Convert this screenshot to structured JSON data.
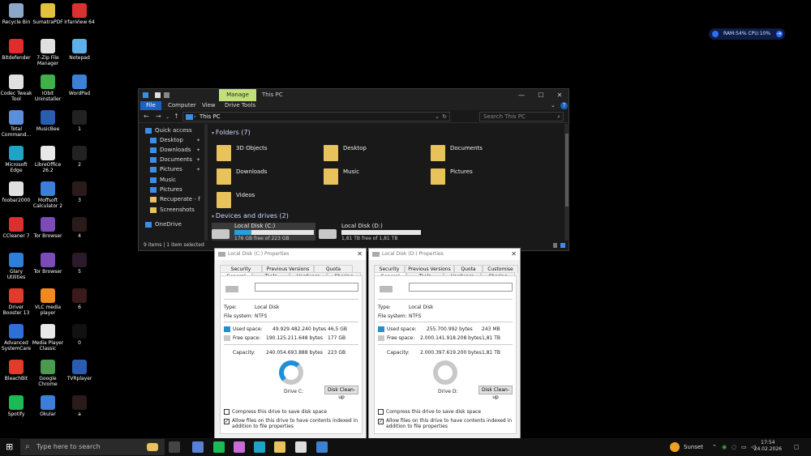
{
  "desktop": {
    "icons": [
      {
        "label": "Recycle Bin",
        "color": "#8aa6c9"
      },
      {
        "label": "SumatraPDF",
        "color": "#e3c03d"
      },
      {
        "label": "IrfanView 64",
        "color": "#d93030"
      },
      {
        "label": "Bitdefender",
        "color": "#e32b2b"
      },
      {
        "label": "7-Zip File Manager",
        "color": "#e0e0e0"
      },
      {
        "label": "Notepad",
        "color": "#5fb0e8"
      },
      {
        "label": "Codec Tweak Tool",
        "color": "#e0e0e0"
      },
      {
        "label": "IObit Uninstaller",
        "color": "#3fb04a"
      },
      {
        "label": "WordPad",
        "color": "#3b82d6"
      },
      {
        "label": "Total Command...",
        "color": "#5c8fd9"
      },
      {
        "label": "MusicBee",
        "color": "#2a5db0"
      },
      {
        "label": "1",
        "color": "#222"
      },
      {
        "label": "Microsoft Edge",
        "color": "#1fa3c6"
      },
      {
        "label": "LibreOffice 26.2",
        "color": "#e8e8e8"
      },
      {
        "label": "2",
        "color": "#222"
      },
      {
        "label": "foobar2000",
        "color": "#e0e0e0"
      },
      {
        "label": "Moffsoft Calculator 2",
        "color": "#3b7fd9"
      },
      {
        "label": "3",
        "color": "#2a1a1a"
      },
      {
        "label": "CCleaner 7",
        "color": "#d93030"
      },
      {
        "label": "Tor Browser",
        "color": "#7d4bb8"
      },
      {
        "label": "4",
        "color": "#2a1a1a"
      },
      {
        "label": "Glary Utilities",
        "color": "#2f7fd9"
      },
      {
        "label": "Tor Browser",
        "color": "#7d4bb8"
      },
      {
        "label": "5",
        "color": "#2a1a2a"
      },
      {
        "label": "Driver Booster 13",
        "color": "#e33b2b"
      },
      {
        "label": "VLC media player",
        "color": "#f08a1c"
      },
      {
        "label": "6",
        "color": "#3a1a1a"
      },
      {
        "label": "Advanced SystemCare",
        "color": "#2f6fd9"
      },
      {
        "label": "Media Player Classic",
        "color": "#e8e8e8"
      },
      {
        "label": "0",
        "color": "#111"
      },
      {
        "label": "BleachBit",
        "color": "#e33b2b"
      },
      {
        "label": "Google Chrome",
        "color": "#4b9a4f"
      },
      {
        "label": "TVRplayer",
        "color": "#2a5db0"
      },
      {
        "label": "Spotify",
        "color": "#1db954"
      },
      {
        "label": "Okular",
        "color": "#3b7fd9"
      },
      {
        "label": "a",
        "color": "#2a1a1a"
      }
    ]
  },
  "widget": {
    "text": "RAM:54%  CPU:10%",
    "arrow": "⇥"
  },
  "explorer": {
    "manage_label": "Manage",
    "title": "This PC",
    "minimize": "—",
    "maximize": "☐",
    "close": "✕",
    "ribbon_tabs": [
      "File",
      "Computer",
      "View",
      "Drive Tools"
    ],
    "help": "?",
    "address": "This PC",
    "search_placeholder": "Search This PC",
    "sidebar": [
      {
        "label": "Quick access",
        "pinned": false,
        "folder": false
      },
      {
        "label": "Desktop",
        "pinned": true,
        "folder": false
      },
      {
        "label": "Downloads",
        "pinned": true,
        "folder": false
      },
      {
        "label": "Documents",
        "pinned": true,
        "folder": false
      },
      {
        "label": "Pictures",
        "pinned": true,
        "folder": false
      },
      {
        "label": "Music",
        "pinned": false,
        "folder": false
      },
      {
        "label": "Pictures",
        "pinned": false,
        "folder": false
      },
      {
        "label": "Recuperate - fot",
        "pinned": false,
        "folder": true
      },
      {
        "label": "Screenshots",
        "pinned": false,
        "folder": true
      },
      {
        "label": "OneDrive",
        "pinned": false,
        "folder": false
      }
    ],
    "folders_heading": "Folders (7)",
    "folders": [
      "3D Objects",
      "Desktop",
      "Documents",
      "Downloads",
      "Music",
      "Pictures",
      "Videos"
    ],
    "drives_heading": "Devices and drives (2)",
    "drives": [
      {
        "name": "Local Disk (C:)",
        "free": "176 GB free of 223 GB",
        "used_fraction": 0.21
      },
      {
        "name": "Local Disk (D:)",
        "free": "1,81 TB free of 1,81 TB",
        "used_fraction": 0.0
      }
    ],
    "status": "9 items  |  1 item selected"
  },
  "dialogs": [
    {
      "title": "Local Disk (C:) Properties",
      "tabs_top": [
        "Security",
        "Previous Versions",
        "Quota"
      ],
      "tabs_bottom": [
        "General",
        "Tools",
        "Hardware",
        "Sharing"
      ],
      "type_label": "Type:",
      "type": "Local Disk",
      "fs_label": "File system:",
      "fs": "NTFS",
      "used_label": "Used space:",
      "used_bytes": "49.929.482.240 bytes",
      "used_size": "46,5 GB",
      "free_label": "Free space:",
      "free_bytes": "190.125.211.648 bytes",
      "free_size": "177 GB",
      "cap_label": "Capacity:",
      "cap_bytes": "240.054.693.888 bytes",
      "cap_size": "223 GB",
      "drive_label": "Drive C:",
      "cleanup": "Disk Clean-up",
      "compress": "Compress this drive to save disk space",
      "index": "Allow files on this drive to have contents indexed in addition to file properties"
    },
    {
      "title": "Local Disk (D:) Properties",
      "tabs_top": [
        "Security",
        "Previous Versions",
        "Quota",
        "Customise"
      ],
      "tabs_bottom": [
        "General",
        "Tools",
        "Hardware",
        "Sharing"
      ],
      "type_label": "Type:",
      "type": "Local Disk",
      "fs_label": "File system:",
      "fs": "NTFS",
      "used_label": "Used space:",
      "used_bytes": "255.700.992 bytes",
      "used_size": "243 MB",
      "free_label": "Free space:",
      "free_bytes": "2.000.141.918.208 bytes",
      "free_size": "1,81 TB",
      "cap_label": "Capacity:",
      "cap_bytes": "2.000.397.619.200 bytes",
      "cap_size": "1,81 TB",
      "drive_label": "Drive D:",
      "cleanup": "Disk Clean-up",
      "compress": "Compress this drive to save disk space",
      "index": "Allow files on this drive to have contents indexed in addition to file properties"
    }
  ],
  "taskbar": {
    "search_placeholder": "Type here to search",
    "weather": "Sunset",
    "time": "17:54",
    "date": "24.02.2026",
    "apps": [
      {
        "name": "task-view",
        "color": "#444"
      },
      {
        "name": "app-1",
        "color": "#5a7fd9"
      },
      {
        "name": "spotify",
        "color": "#1db954"
      },
      {
        "name": "app-3",
        "color": "#c86bd9"
      },
      {
        "name": "edge",
        "color": "#1fa3c6"
      },
      {
        "name": "file-explorer",
        "color": "#e8c35b"
      },
      {
        "name": "app-6",
        "color": "#ddd"
      },
      {
        "name": "app-7",
        "color": "#3b82d6"
      }
    ]
  }
}
